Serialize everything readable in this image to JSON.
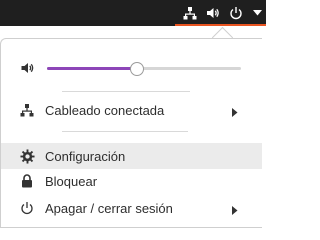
{
  "top_bar": {
    "icons": [
      "network-wired-icon",
      "speaker-icon",
      "power-icon",
      "caret-down-icon"
    ]
  },
  "menu": {
    "volume": {
      "level_fraction": 0.46,
      "icon": "speaker-icon"
    },
    "wired": {
      "label": "Cableado conectada",
      "icon": "network-wired-icon",
      "has_submenu": true
    },
    "settings": {
      "label": "Configuración",
      "icon": "gear-icon"
    },
    "lock": {
      "label": "Bloquear",
      "icon": "lock-icon"
    },
    "power": {
      "label": "Apagar / cerrar sesión",
      "icon": "power-icon",
      "has_submenu": true
    }
  },
  "colors": {
    "accent": "#e95420",
    "slider_fill": "#8d46b8",
    "top_bar": "#1f1f1f",
    "hover_row": "#ebebeb"
  }
}
